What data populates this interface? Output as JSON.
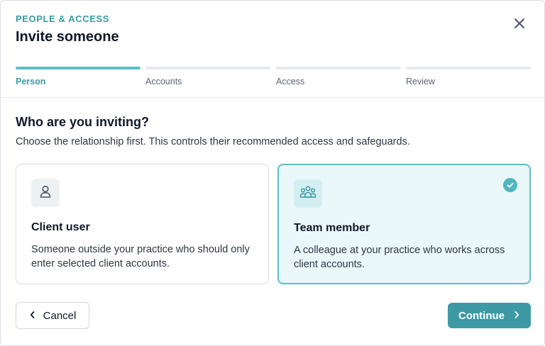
{
  "header": {
    "eyebrow": "PEOPLE & ACCESS",
    "title": "Invite someone",
    "close_icon": "close-icon"
  },
  "steps": [
    {
      "label": "Person",
      "active": true
    },
    {
      "label": "Accounts",
      "active": false
    },
    {
      "label": "Access",
      "active": false
    },
    {
      "label": "Review",
      "active": false
    }
  ],
  "main": {
    "question": "Who are you inviting?",
    "hint": "Choose the relationship first. This controls their recommended access and safeguards.",
    "options": [
      {
        "icon": "person-icon",
        "title": "Client user",
        "description": "Someone outside your practice who should only enter selected client accounts.",
        "selected": false
      },
      {
        "icon": "team-icon",
        "title": "Team member",
        "description": "A colleague at your practice who works across client accounts.",
        "selected": true
      }
    ]
  },
  "footer": {
    "cancel_label": "Cancel",
    "continue_label": "Continue"
  },
  "colors": {
    "accent": "#3d9aa5",
    "accent_light": "#5cbfc7",
    "selected_bg": "#eaf8fa"
  }
}
